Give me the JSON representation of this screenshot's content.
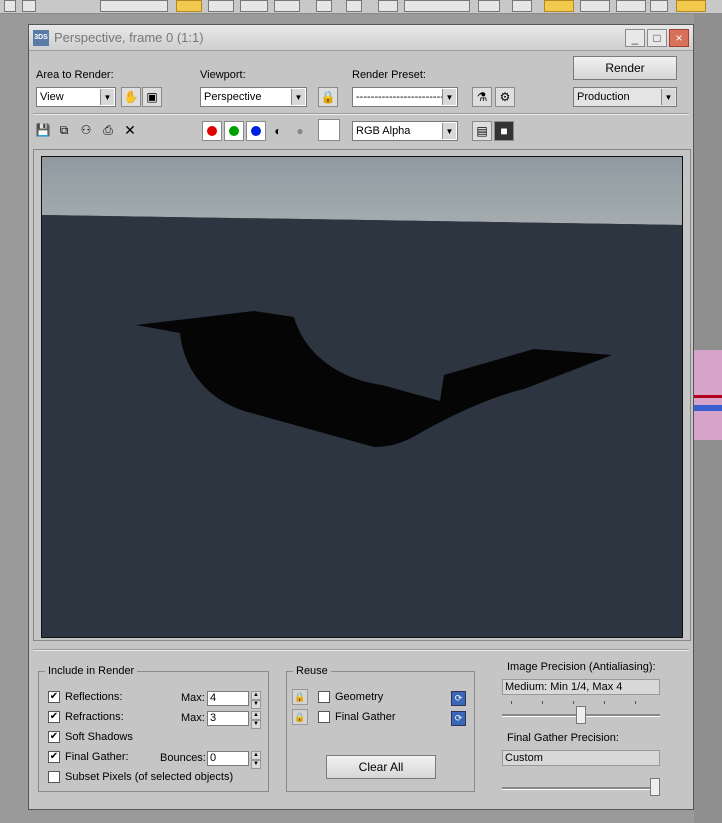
{
  "window": {
    "title": "Perspective, frame 0 (1:1)",
    "app_icon_text": "3DS",
    "buttons": {
      "minimize": "_",
      "maximize": "□",
      "close": "×"
    }
  },
  "top_controls": {
    "area_to_render": {
      "label": "Area to Render:",
      "value": "View"
    },
    "viewport": {
      "label": "Viewport:",
      "value": "Perspective"
    },
    "render_preset": {
      "label": "Render Preset:",
      "value": "-------------------------"
    },
    "render_button": "Render",
    "production": {
      "value": "Production"
    }
  },
  "toolbar": {
    "channel_display": {
      "value": "RGB Alpha"
    },
    "channels": {
      "red": "#e00000",
      "green": "#00a000",
      "blue": "#0020e0"
    }
  },
  "render": {
    "sky_color": "#8f9aa0",
    "ground_color": "#2d3540",
    "object_color": "#050505"
  },
  "include_in_render": {
    "title": "Include in Render",
    "reflections": {
      "label": "Reflections:",
      "checked": true,
      "max_label": "Max:",
      "max_value": "4"
    },
    "refractions": {
      "label": "Refractions:",
      "checked": true,
      "max_label": "Max:",
      "max_value": "3"
    },
    "soft_shadows": {
      "label": "Soft Shadows",
      "checked": true
    },
    "final_gather": {
      "label": "Final Gather:",
      "checked": true,
      "bounces_label": "Bounces:",
      "bounces_value": "0"
    },
    "subset_pixels": {
      "label": "Subset Pixels (of selected objects)",
      "checked": false
    }
  },
  "reuse": {
    "title": "Reuse",
    "geometry": {
      "label": "Geometry",
      "checked": false
    },
    "final_gather": {
      "label": "Final Gather",
      "checked": false
    },
    "clear_all": "Clear All"
  },
  "precision": {
    "image_label": "Image Precision (Antialiasing):",
    "image_value": "Medium: Min 1/4, Max 4",
    "image_level": 0.5,
    "fg_label": "Final Gather Precision:",
    "fg_value": "Custom",
    "fg_level": 1.0
  }
}
